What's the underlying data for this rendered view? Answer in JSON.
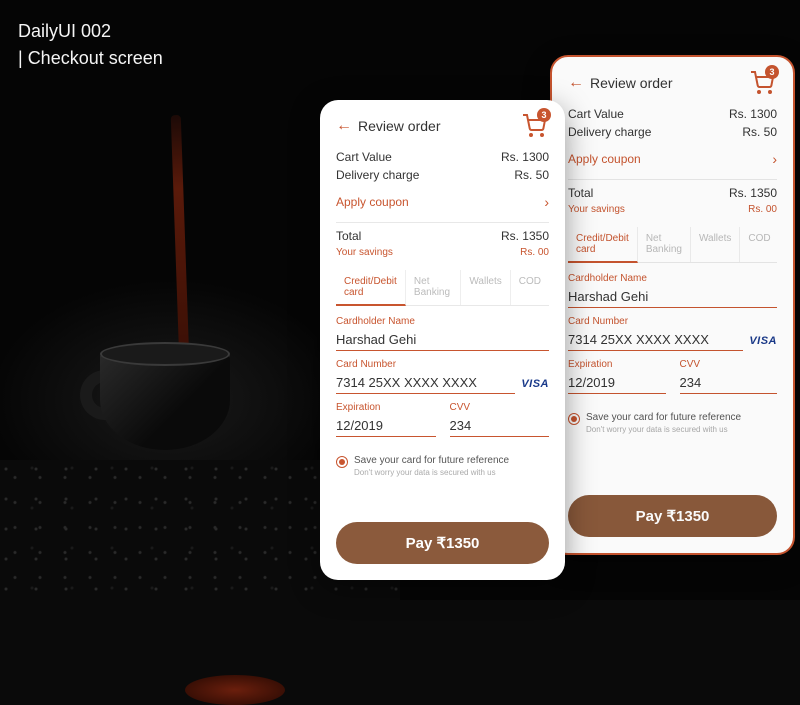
{
  "title": {
    "line1": "DailyUI 002",
    "line2": "Checkout screen"
  },
  "colors": {
    "accent": "#c8552f",
    "button": "#8b5a3c"
  },
  "checkout": {
    "header_title": "Review order",
    "cart_count": "3",
    "summary": {
      "cart_value_label": "Cart Value",
      "cart_value": "Rs. 1300",
      "delivery_label": "Delivery charge",
      "delivery_value": "Rs. 50",
      "coupon_label": "Apply coupon",
      "total_label": "Total",
      "total_value": "Rs. 1350",
      "savings_label": "Your savings",
      "savings_value": "Rs. 00"
    },
    "tabs": [
      "Credit/Debit card",
      "Net Banking",
      "Wallets",
      "COD"
    ],
    "active_tab": "Credit/Debit card",
    "form": {
      "name_label": "Cardholder Name",
      "name_value": "Harshad Gehi",
      "card_label": "Card Number",
      "card_value": "7314 25XX XXXX XXXX",
      "card_brand": "VISA",
      "exp_label": "Expiration",
      "exp_value": "12/2019",
      "cvv_label": "CVV",
      "cvv_value": "234",
      "save_label": "Save your card for future reference",
      "save_sub": "Don't worry your data is secured with us"
    },
    "pay_label": "Pay ₹1350"
  }
}
